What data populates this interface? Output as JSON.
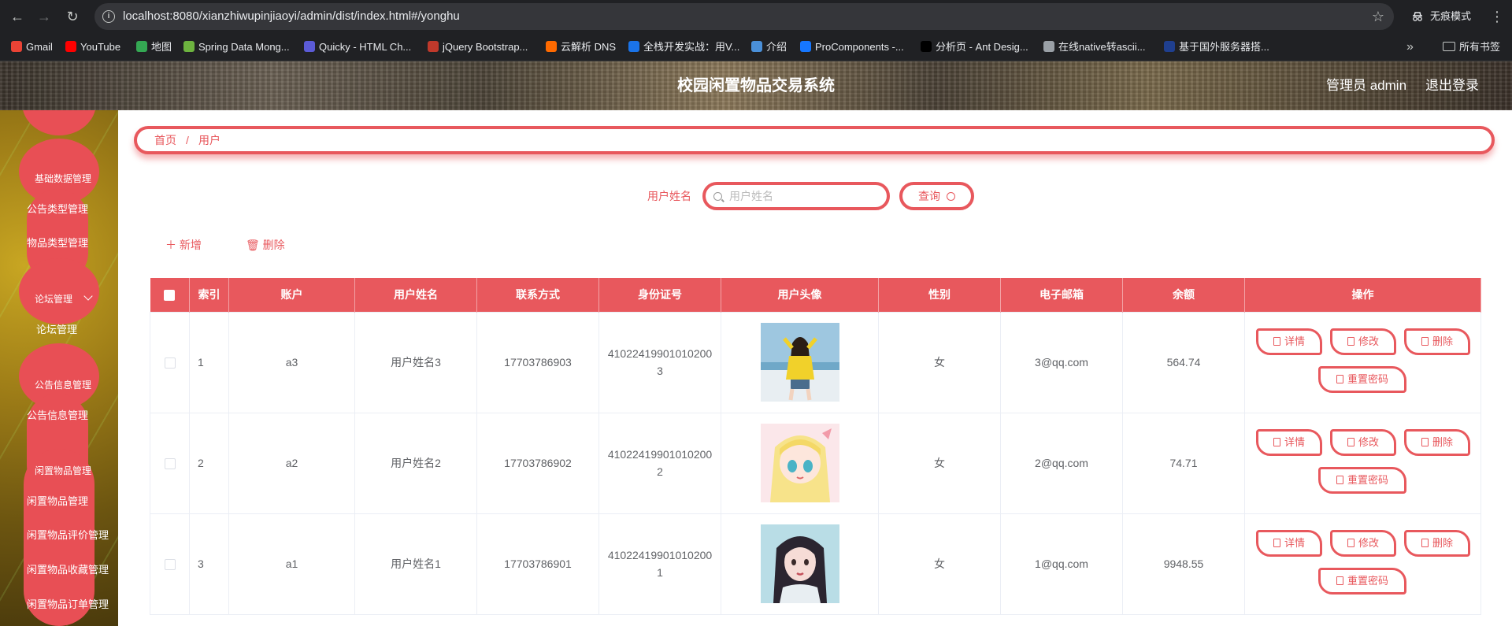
{
  "browser": {
    "url": "localhost:8080/xianzhiwupinjiaoyi/admin/dist/index.html#/yonghu",
    "incognito_label": "无痕模式",
    "bookmarks": [
      {
        "label": "Gmail",
        "color": "#ea4335"
      },
      {
        "label": "YouTube",
        "color": "#ff0000"
      },
      {
        "label": "地图",
        "color": "#34a853"
      },
      {
        "label": "Spring Data Mong...",
        "color": "#6db33f"
      },
      {
        "label": "Quicky - HTML Ch...",
        "color": "#5b5bd6"
      },
      {
        "label": "jQuery Bootstrap...",
        "color": "#c0392b"
      },
      {
        "label": "云解析 DNS",
        "color": "#ff6a00"
      },
      {
        "label": "全栈开发实战：用V...",
        "color": "#1a73e8"
      },
      {
        "label": "介绍",
        "color": "#4a90d9"
      },
      {
        "label": "ProComponents -...",
        "color": "#1677ff"
      },
      {
        "label": "分析页 - Ant Desig...",
        "color": "#000000"
      },
      {
        "label": "在线native转ascii...",
        "color": "#9aa0a6"
      },
      {
        "label": "基于国外服务器搭...",
        "color": "#1f3f8f"
      }
    ],
    "all_bookmarks_label": "所有书签"
  },
  "header": {
    "title": "校园闲置物品交易系统",
    "admin_label": "管理员 admin",
    "logout_label": "退出登录"
  },
  "sidebar": {
    "items": [
      {
        "label": "基础数据管理"
      },
      {
        "label": "公告类型管理"
      },
      {
        "label": "物品类型管理"
      },
      {
        "label": "论坛管理"
      },
      {
        "label": "论坛管理"
      },
      {
        "label": "公告信息管理"
      },
      {
        "label": "公告信息管理"
      },
      {
        "label": "闲置物品管理"
      },
      {
        "label": "闲置物品管理"
      },
      {
        "label": "闲置物品评价管理"
      },
      {
        "label": "闲置物品收藏管理"
      },
      {
        "label": "闲置物品订单管理"
      }
    ]
  },
  "breadcrumb": {
    "home": "首页",
    "separator": "/",
    "current": "用户"
  },
  "search": {
    "label": "用户姓名",
    "placeholder": "用户姓名",
    "button_label": "查询"
  },
  "toolbar": {
    "add_label": "新增",
    "delete_label": "删除"
  },
  "table": {
    "columns": [
      "索引",
      "账户",
      "用户姓名",
      "联系方式",
      "身份证号",
      "用户头像",
      "性别",
      "电子邮箱",
      "余额",
      "操作"
    ],
    "rows": [
      {
        "index": "1",
        "account": "a3",
        "name": "用户姓名3",
        "phone": "17703786903",
        "id_card": "410224199010102003",
        "gender": "女",
        "email": "3@qq.com",
        "balance": "564.74",
        "avatar": "photo-girl-yellow"
      },
      {
        "index": "2",
        "account": "a2",
        "name": "用户姓名2",
        "phone": "17703786902",
        "id_card": "410224199010102002",
        "gender": "女",
        "email": "2@qq.com",
        "balance": "74.71",
        "avatar": "anime-girl-blonde"
      },
      {
        "index": "3",
        "account": "a1",
        "name": "用户姓名1",
        "phone": "17703786901",
        "id_card": "410224199010102001",
        "gender": "女",
        "email": "1@qq.com",
        "balance": "9948.55",
        "avatar": "photo-girl-blue"
      }
    ],
    "actions": {
      "detail": "详情",
      "edit": "修改",
      "delete": "删除",
      "reset_password": "重置密码"
    }
  },
  "colors": {
    "accent": "#e8585d"
  }
}
